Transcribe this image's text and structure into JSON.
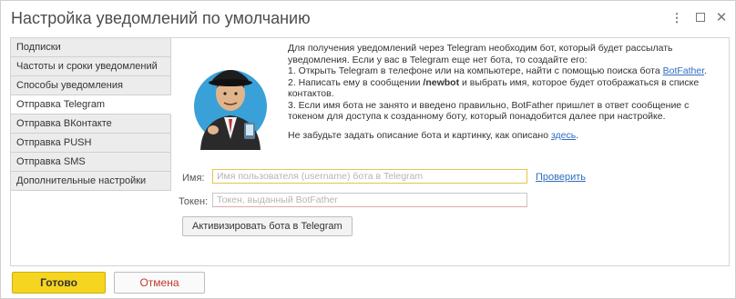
{
  "window": {
    "title": "Настройка уведомлений по умолчанию",
    "menu_glyph": "⋮",
    "close_glyph": "✕"
  },
  "sidebar": {
    "items": [
      {
        "label": "Подписки"
      },
      {
        "label": "Частоты и сроки уведомлений"
      },
      {
        "label": "Способы уведомления"
      },
      {
        "label": "Отправка Telegram",
        "active": true
      },
      {
        "label": "Отправка ВКонтакте"
      },
      {
        "label": "Отправка PUSH"
      },
      {
        "label": "Отправка SMS"
      },
      {
        "label": "Дополнительные настройки"
      }
    ]
  },
  "info": {
    "intro": "Для получения уведомлений через Telegram необходим бот, который будет рассылать уведомления. Если у вас в Telegram еще нет бота, то создайте его:",
    "step1": "1. Открыть Telegram в телефоне или на компьютере, найти с помощью поиска бота",
    "step1_link": "BotFather",
    "step1_end": ".",
    "step2_prefix": "2. Написать ему в сообщении ",
    "step2_bold": "/newbot",
    "step2_suffix": " и выбрать имя, которое будет отображаться в списке контактов.",
    "step3": "3. Если имя бота не занято и введено правильно, BotFather пришлет в ответ сообщение с токеном для доступа к созданному боту, который понадобится далее при настройке.",
    "reminder": "Не забудьте задать описание бота и картинку, как описано ",
    "reminder_link": "здесь",
    "reminder_end": "."
  },
  "form": {
    "name_label": "Имя:",
    "name_placeholder": "Имя пользователя (username) бота в Telegram",
    "name_value": "",
    "check_link": "Проверить",
    "token_label": "Токен:",
    "token_placeholder": "Токен, выданный BotFather",
    "token_value": "",
    "activate_button": "Активизировать бота в Telegram"
  },
  "footer": {
    "ok_button": "Готово",
    "cancel_button": "Отмена"
  },
  "colors": {
    "accent_yellow": "#f5d51f",
    "link_blue": "#2f6cc2",
    "cancel_red": "#c0392b"
  }
}
